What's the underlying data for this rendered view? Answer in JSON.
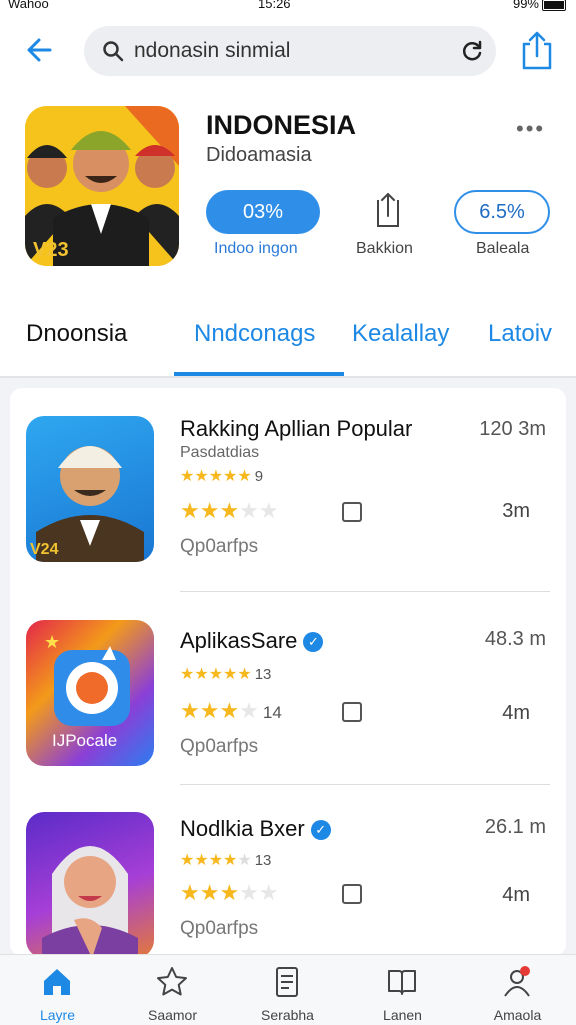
{
  "status": {
    "carrier": "Wahoo",
    "time": "15:26",
    "battery": "99%"
  },
  "search": {
    "query": "ndonasin sinmial"
  },
  "app": {
    "title": "INDONESIA",
    "subtitle": "Didoamasia",
    "badge_text": "V23",
    "button_primary": "03%",
    "button_secondary": "6.5%",
    "caption_primary": "Indoo ingon",
    "caption_middle": "Bakkion",
    "caption_secondary": "Baleala"
  },
  "tabs": [
    "Dnoonsia",
    "Nndconags",
    "Kealallay",
    "Latoiv"
  ],
  "list": [
    {
      "title": "Rakking Apllian Popular",
      "size": "120 3m",
      "subtitle": "Pasdatdias",
      "rating_small": "9",
      "rating_big": "",
      "downloads": "3m",
      "action": "Qp0arfps",
      "thumb_label": "V24"
    },
    {
      "title": "AplikasSare",
      "size": "48.3 m",
      "subtitle": "",
      "rating_small": "13",
      "rating_big": "14",
      "downloads": "4m",
      "action": "Qp0arfps",
      "thumb_label": "IJPocale"
    },
    {
      "title": "Nodlkia Bxer",
      "size": "26.1 m",
      "subtitle": "",
      "rating_small": "13",
      "rating_big": "",
      "downloads": "4m",
      "action": "Qp0arfps",
      "thumb_label": ""
    }
  ],
  "nav": [
    {
      "label": "Layre",
      "icon": "home-icon"
    },
    {
      "label": "Saamor",
      "icon": "star-icon"
    },
    {
      "label": "Serabha",
      "icon": "document-icon"
    },
    {
      "label": "Lanen",
      "icon": "book-icon"
    },
    {
      "label": "Amaola",
      "icon": "profile-icon"
    }
  ],
  "colors": {
    "accent": "#1e88e5",
    "star": "#f6b81c"
  }
}
